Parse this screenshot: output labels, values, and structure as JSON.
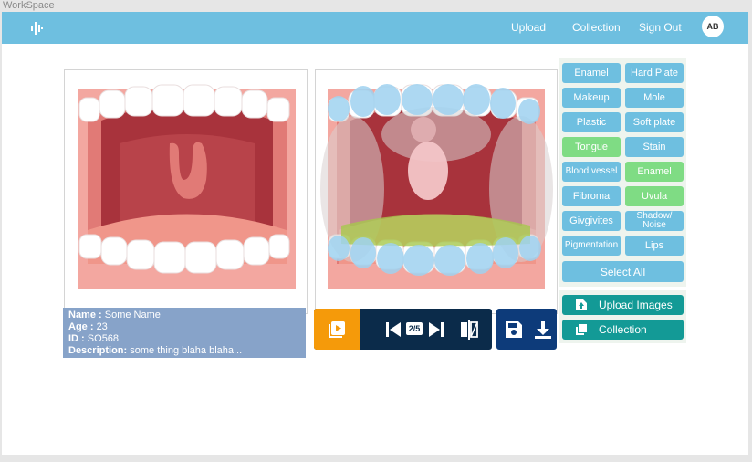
{
  "workspace_label": "WorkSpace",
  "nav": {
    "links": [
      "Upload",
      "Collection",
      "Sign Out"
    ],
    "avatar": "AB"
  },
  "tags": [
    {
      "label": "Enamel",
      "active": false
    },
    {
      "label": "Hard Plate",
      "active": false
    },
    {
      "label": "Makeup",
      "active": false
    },
    {
      "label": "Mole",
      "active": false
    },
    {
      "label": "Plastic",
      "active": false
    },
    {
      "label": "Soft plate",
      "active": false
    },
    {
      "label": "Tongue",
      "active": true
    },
    {
      "label": "Stain",
      "active": false
    },
    {
      "label": "Blood vessel",
      "active": false
    },
    {
      "label": "Enamel",
      "active": true
    },
    {
      "label": "Fibroma",
      "active": false
    },
    {
      "label": "Uvula",
      "active": true
    },
    {
      "label": "Givgivites",
      "active": false
    },
    {
      "label": "Shadow/ Noise",
      "active": false
    },
    {
      "label": "Pigmentation",
      "active": false
    },
    {
      "label": "Lips",
      "active": false
    }
  ],
  "select_all": "Select All",
  "info": {
    "name_label": "Name :",
    "name": "Some Name",
    "age_label": "Age :",
    "age": "23",
    "id_label": "ID :",
    "id": "SO568",
    "desc_label": "Description:",
    "desc": "some thing blaha blaha..."
  },
  "viewer": {
    "counter": "2/5"
  },
  "actions": {
    "upload_images": "Upload Images",
    "collection": "Collection"
  },
  "colors": {
    "nav": "#6ebfe0",
    "tag": "#6ebfe0",
    "tag_active": "#7fdc84",
    "teal": "#139a96",
    "orange": "#f59a0a",
    "navy": "#0b2b4a"
  }
}
